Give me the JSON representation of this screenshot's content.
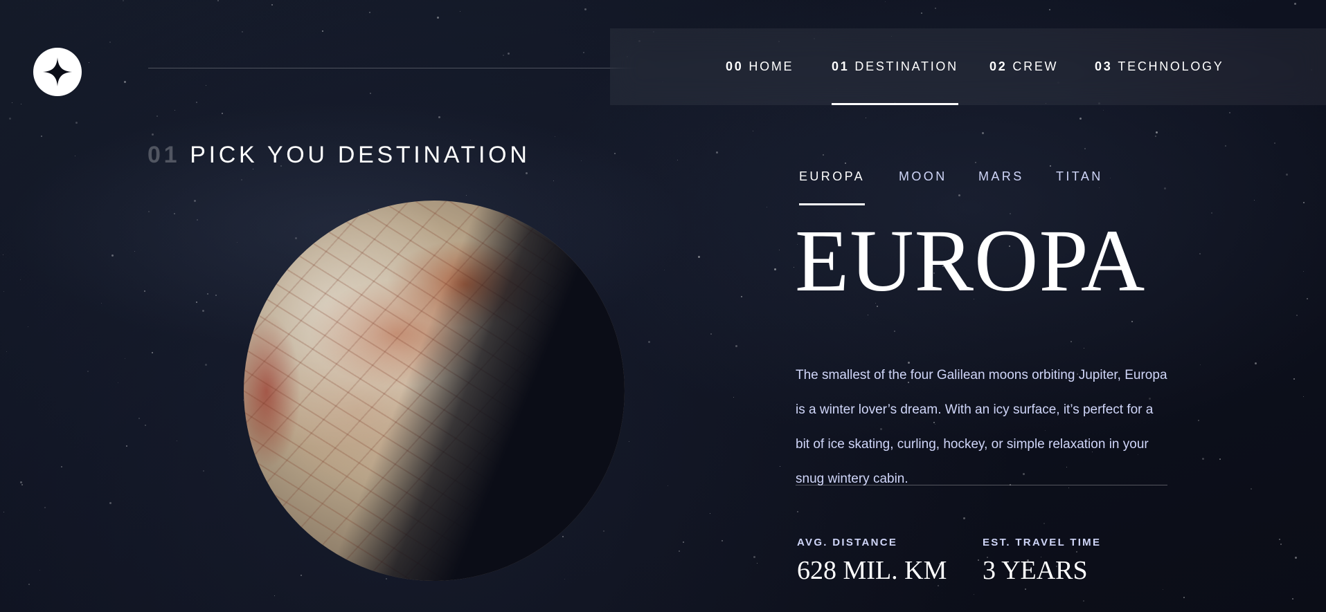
{
  "header": {
    "logo_icon": "star-logo-icon",
    "nav": [
      {
        "num": "00",
        "label": "HOME",
        "active": false
      },
      {
        "num": "01",
        "label": "DESTINATION",
        "active": true
      },
      {
        "num": "02",
        "label": "CREW",
        "active": false
      },
      {
        "num": "03",
        "label": "TECHNOLOGY",
        "active": false
      }
    ]
  },
  "page": {
    "heading_num": "01",
    "heading_text": "PICK YOU DESTINATION"
  },
  "destination": {
    "tabs": [
      {
        "label": "EUROPA",
        "active": true
      },
      {
        "label": "MOON",
        "active": false
      },
      {
        "label": "MARS",
        "active": false
      },
      {
        "label": "TITAN",
        "active": false
      }
    ],
    "name": "EUROPA",
    "description": "The smallest of the four Galilean moons orbiting Jupiter, Europa is a winter lover’s dream. With an icy surface, it’s perfect for a bit of ice skating, curling, hockey, or simple relaxation in your snug wintery cabin.",
    "stats": [
      {
        "label": "AVG. DISTANCE",
        "value": "628 MIL. KM"
      },
      {
        "label": "EST. TRAVEL TIME",
        "value": "3 YEARS"
      }
    ]
  },
  "colors": {
    "background": "#0b0d17",
    "accent_text": "#d0d6f9",
    "white": "#ffffff"
  }
}
